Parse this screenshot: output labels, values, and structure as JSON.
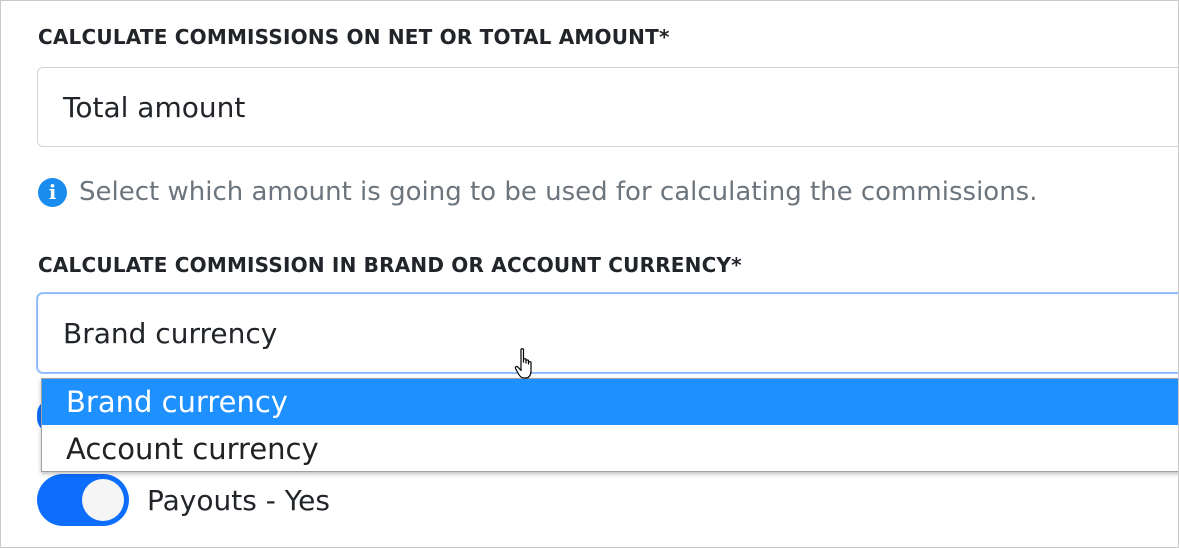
{
  "commission_basis": {
    "label": "CALCULATE COMMISSIONS ON NET OR TOTAL AMOUNT*",
    "selected_value": "Total amount",
    "help_text": "Select which amount is going to be used for calculating the commissions."
  },
  "commission_currency": {
    "label": "CALCULATE COMMISSION IN BRAND OR ACCOUNT CURRENCY*",
    "selected_value": "Brand currency",
    "options": [
      {
        "label": "Brand currency",
        "highlighted": true
      },
      {
        "label": "Account currency",
        "highlighted": false
      }
    ]
  },
  "payouts_toggle": {
    "label": "Payouts - Yes",
    "on": true
  },
  "colors": {
    "accent": "#0d6efd",
    "option_highlight": "#1e90ff",
    "info_icon": "#1a8cf0",
    "help_text": "#6c757d"
  },
  "icons": {
    "info": "info-circle-icon",
    "cursor": "hand-pointer-cursor-icon"
  }
}
